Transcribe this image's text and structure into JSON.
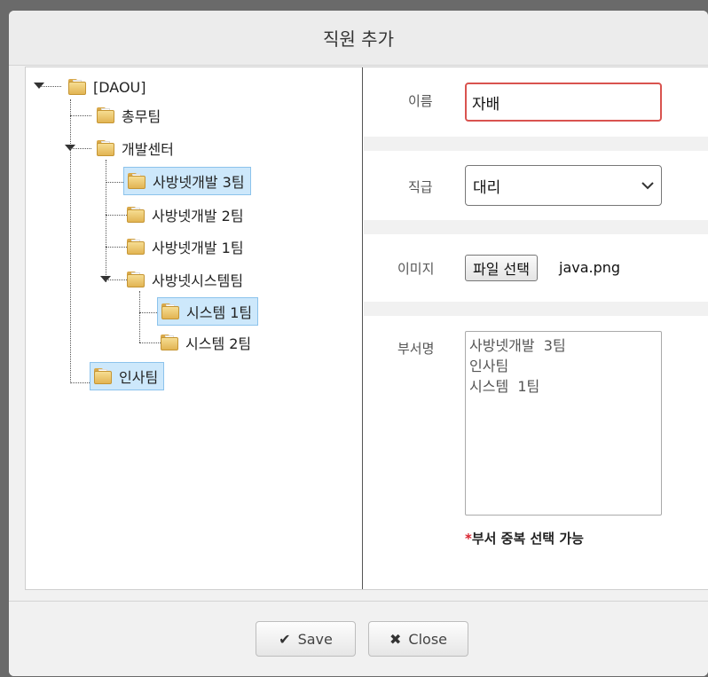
{
  "dialog": {
    "title": "직원 추가"
  },
  "tree": {
    "nodes": [
      {
        "label": "[DAOU]",
        "selected": false
      },
      {
        "label": "총무팀",
        "selected": false
      },
      {
        "label": "개발센터",
        "selected": false
      },
      {
        "label": "사방넷개발 3팀",
        "selected": true
      },
      {
        "label": "사방넷개발 2팀",
        "selected": false
      },
      {
        "label": "사방넷개발 1팀",
        "selected": false
      },
      {
        "label": "사방넷시스템팀",
        "selected": false
      },
      {
        "label": "시스템 1팀",
        "selected": true
      },
      {
        "label": "시스템 2팀",
        "selected": false
      },
      {
        "label": "인사팀",
        "selected": true
      }
    ]
  },
  "form": {
    "name": {
      "label": "이름",
      "value": "자배"
    },
    "position": {
      "label": "직급",
      "value": "대리"
    },
    "image": {
      "label": "이미지",
      "button": "파일 선택",
      "filename": "java.png"
    },
    "dept": {
      "label": "부서명",
      "items": [
        "사방넷개발  3팀",
        "인사팀",
        "시스템  1팀"
      ]
    },
    "note_star": "*",
    "note": "부서 중복 선택 가능"
  },
  "footer": {
    "save": "Save",
    "close": "Close"
  },
  "colors": {
    "accent_invalid": "#d9534f",
    "selection": "#cde8fb",
    "note_star": "#d9232e"
  }
}
